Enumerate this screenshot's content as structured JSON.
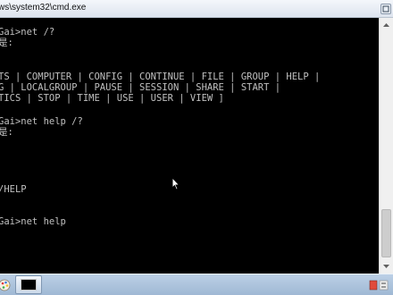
{
  "window": {
    "title": "ws\\system32\\cmd.exe"
  },
  "console": {
    "lines": [
      "",
      "Gai>net /?",
      "是:",
      "",
      "",
      "TS | COMPUTER | CONFIG | CONTINUE | FILE | GROUP | HELP |",
      "G | LOCALGROUP | PAUSE | SESSION | SHARE | START |",
      "TICS | STOP | TIME | USE | USER | VIEW ]",
      "",
      "Gai>net help /?",
      "是:",
      "",
      "",
      "",
      "",
      "/HELP",
      "",
      "",
      "Gai>net help"
    ]
  },
  "icons": {
    "titlebar_button": "restore-icon",
    "mouse_cursor": "arrow-cursor-icon",
    "taskbar_app_1": "paint-icon",
    "taskbar_app_2": "cmd-icon",
    "tray": "tray-icon"
  },
  "colors": {
    "console_background": "#000000",
    "console_text": "#c0c0c0",
    "titlebar": "#e8edf4",
    "taskbar": "#afc5de"
  }
}
